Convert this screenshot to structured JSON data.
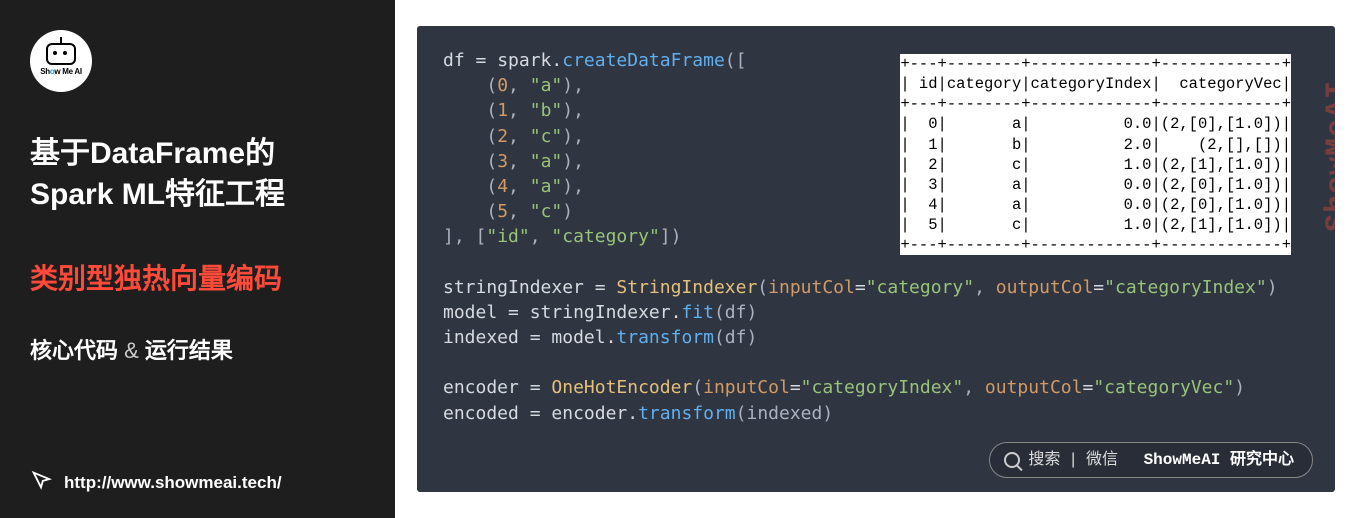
{
  "sidebar": {
    "logo_text_pre": "Sh",
    "logo_text_o": "o",
    "logo_text_post": "w Me AI",
    "title_l1": "基于DataFrame的",
    "title_l2": "Spark ML特征工程",
    "subtitle": "类别型独热向量编码",
    "caption_core": "核心代码",
    "caption_amp": " & ",
    "caption_run": "运行结果",
    "url": "http://www.showmeai.tech/"
  },
  "code": {
    "l1_a": "df ",
    "l1_b": "= ",
    "l1_c": "spark",
    "l1_d": ".",
    "l1_e": "createDataFrame",
    "l1_f": "([",
    "tuples": [
      {
        "n": "0",
        "s": "\"a\""
      },
      {
        "n": "1",
        "s": "\"b\""
      },
      {
        "n": "2",
        "s": "\"c\""
      },
      {
        "n": "3",
        "s": "\"a\""
      },
      {
        "n": "4",
        "s": "\"a\""
      },
      {
        "n": "5",
        "s": "\"c\""
      }
    ],
    "l8_a": "], [",
    "l8_b": "\"id\"",
    "l8_c": ", ",
    "l8_d": "\"category\"",
    "l8_e": "])",
    "s1_a": "stringIndexer ",
    "s1_b": "= ",
    "s1_c": "StringIndexer",
    "s1_d": "(",
    "s1_e": "inputCol",
    "s1_f": "=",
    "s1_g": "\"category\"",
    "s1_h": ", ",
    "s1_i": "outputCol",
    "s1_j": "=",
    "s1_k": "\"categoryIndex\"",
    "s1_l": ")",
    "s2_a": "model ",
    "s2_b": "= ",
    "s2_c": "stringIndexer",
    "s2_d": ".",
    "s2_e": "fit",
    "s2_f": "(df)",
    "s3_a": "indexed ",
    "s3_b": "= ",
    "s3_c": "model",
    "s3_d": ".",
    "s3_e": "transform",
    "s3_f": "(df)",
    "e1_a": "encoder ",
    "e1_b": "= ",
    "e1_c": "OneHotEncoder",
    "e1_d": "(",
    "e1_e": "inputCol",
    "e1_f": "=",
    "e1_g": "\"categoryIndex\"",
    "e1_h": ", ",
    "e1_i": "outputCol",
    "e1_j": "=",
    "e1_k": "\"categoryVec\"",
    "e1_l": ")",
    "e2_a": "encoded ",
    "e2_b": "= ",
    "e2_c": "encoder",
    "e2_d": ".",
    "e2_e": "transform",
    "e2_f": "(indexed)"
  },
  "output": {
    "sep": "+---+--------+-------------+-------------+",
    "head": "| id|category|categoryIndex|  categoryVec|",
    "rows": [
      "|  0|       a|          0.0|(2,[0],[1.0])|",
      "|  1|       b|          2.0|    (2,[],[])|",
      "|  2|       c|          1.0|(2,[1],[1.0])|",
      "|  3|       a|          0.0|(2,[0],[1.0])|",
      "|  4|       a|          0.0|(2,[0],[1.0])|",
      "|  5|       c|          1.0|(2,[1],[1.0])|"
    ]
  },
  "watermark": "ShowMeAI",
  "search": {
    "t1": "搜索",
    "sep": " | ",
    "t2": "微信",
    "brand": "ShowMeAI 研究中心"
  }
}
